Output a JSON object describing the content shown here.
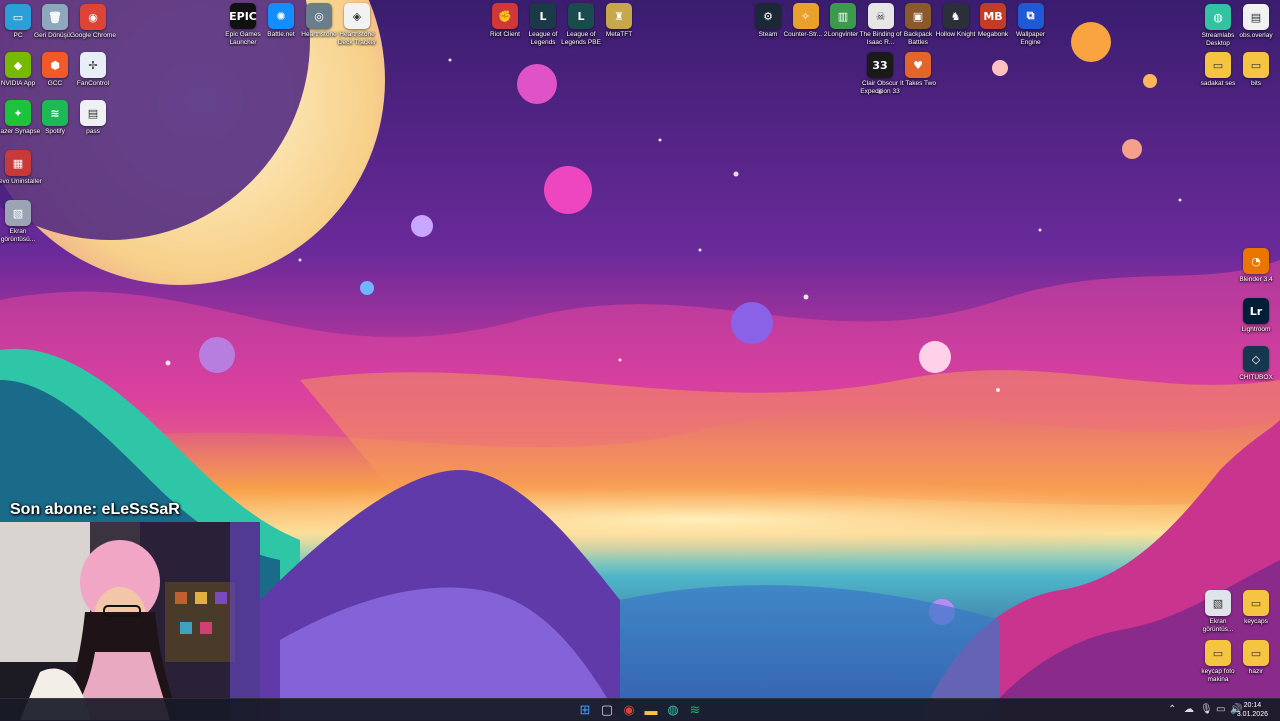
{
  "desktop": {
    "left_icons": [
      {
        "name": "pc",
        "label": "PC",
        "color": "#2a9fd8",
        "glyph": "▭"
      },
      {
        "name": "recycle-bin",
        "label": "Geri Dönüşü...",
        "color": "#8fa7bd",
        "glyph": "🗑"
      },
      {
        "name": "google-chrome",
        "label": "Google Chrome",
        "color": "#db4437",
        "glyph": "◉"
      },
      {
        "name": "nvidia-app",
        "label": "NVIDIA App",
        "color": "#76b900",
        "glyph": "◆"
      },
      {
        "name": "gcc",
        "label": "GCC",
        "color": "#f05a28",
        "glyph": "⬢"
      },
      {
        "name": "fancontrol",
        "label": "FanControl",
        "color": "#e8eef5",
        "glyph": "✢"
      },
      {
        "name": "razer-synapse",
        "label": "Razer Synapse",
        "color": "#1cc43c",
        "glyph": "✦"
      },
      {
        "name": "spotify",
        "label": "Spotify",
        "color": "#1db954",
        "glyph": "≋"
      },
      {
        "name": "pass",
        "label": "pass",
        "color": "#eef0f3",
        "glyph": "▤"
      },
      {
        "name": "revo-uninstaller",
        "label": "Revo Uninstaller",
        "color": "#c83a3a",
        "glyph": "▦"
      },
      {
        "name": "ekran-goruntusu-left",
        "label": "Ekran görüntüsü...",
        "color": "#9aa4b5",
        "glyph": "▧"
      }
    ],
    "top_icons_a": [
      {
        "name": "epic-games",
        "label": "Epic Games Launcher",
        "color": "#111111",
        "glyph": "EPIC"
      },
      {
        "name": "battlenet",
        "label": "Battle.net",
        "color": "#148eff",
        "glyph": "✺"
      },
      {
        "name": "hearthstone",
        "label": "Hearthstone",
        "color": "#6a7d8a",
        "glyph": "◎"
      },
      {
        "name": "hearthstone-deck-tracker",
        "label": "Hearthstone Deck Tracker",
        "color": "#f2f2f2",
        "glyph": "◈"
      }
    ],
    "top_icons_b": [
      {
        "name": "riot-client",
        "label": "Riot Client",
        "color": "#d13639",
        "glyph": "✊"
      },
      {
        "name": "league-of-legends",
        "label": "League of Legends",
        "color": "#1a3a48",
        "glyph": "L"
      },
      {
        "name": "league-of-legends-pbe",
        "label": "League of Legends PBE",
        "color": "#1a4c4e",
        "glyph": "L"
      },
      {
        "name": "metatft",
        "label": "MetaTFT",
        "color": "#c7a74c",
        "glyph": "♜"
      }
    ],
    "top_icons_c": [
      {
        "name": "steam",
        "label": "Steam",
        "color": "#1b2838",
        "glyph": "⚙"
      },
      {
        "name": "counter-strike-2",
        "label": "Counter-Str... 2",
        "color": "#e9a12c",
        "glyph": "✧"
      },
      {
        "name": "longvinter",
        "label": "Longvinter",
        "color": "#3c9a4e",
        "glyph": "▥"
      },
      {
        "name": "binding-of-isaac",
        "label": "The Binding of Isaac R...",
        "color": "#e6e6e6",
        "glyph": "☠"
      },
      {
        "name": "backpack-battles",
        "label": "Backpack Battles",
        "color": "#8a5a2b",
        "glyph": "▣"
      },
      {
        "name": "hollow-knight",
        "label": "Hollow Knight",
        "color": "#2a2f3a",
        "glyph": "♞"
      },
      {
        "name": "megabonk",
        "label": "Megabonk",
        "color": "#c33c28",
        "glyph": "MB"
      },
      {
        "name": "wallpaper-engine",
        "label": "Wallpaper Engine",
        "color": "#2059d6",
        "glyph": "⧉"
      }
    ],
    "top_icons_c2": [
      {
        "name": "clair-obscur",
        "label": "Clair Obscur Expedition 33",
        "color": "#1a1a1a",
        "glyph": "33"
      },
      {
        "name": "it-takes-two",
        "label": "It Takes Two",
        "color": "#e2662c",
        "glyph": "♥"
      }
    ],
    "right_icons": [
      {
        "name": "streamlabs",
        "label": "Streamlabs Desktop",
        "color": "#31c3a2",
        "glyph": "◍"
      },
      {
        "name": "obs-overlay",
        "label": "obs.overlay",
        "color": "#f1f1f1",
        "glyph": "▤"
      },
      {
        "name": "sadakat-ses",
        "label": "sadakat ses",
        "color": "#f5c542",
        "glyph": "▭"
      },
      {
        "name": "bits",
        "label": "bits",
        "color": "#f5c542",
        "glyph": "▭"
      },
      {
        "name": "blender",
        "label": "Blender 3.4",
        "color": "#ea7600",
        "glyph": "◔"
      },
      {
        "name": "lightroom",
        "label": "Lightroom",
        "color": "#001e36",
        "glyph": "Lr"
      },
      {
        "name": "chitubox",
        "label": "CHITUBOX",
        "color": "#15384e",
        "glyph": "◇"
      },
      {
        "name": "ekran-goruntusu-right",
        "label": "Ekran görüntüs...",
        "color": "#dfe3ea",
        "glyph": "▧"
      },
      {
        "name": "keycaps",
        "label": "keycaps",
        "color": "#f5c542",
        "glyph": "▭"
      },
      {
        "name": "keycap-foto-makina",
        "label": "keycap foto makina",
        "color": "#f5c542",
        "glyph": "▭"
      },
      {
        "name": "hazir",
        "label": "hazır",
        "color": "#f5c542",
        "glyph": "▭"
      }
    ]
  },
  "overlay": {
    "text": "Son abone: eLeSsSaR"
  },
  "taskbar": {
    "apps": [
      {
        "name": "start",
        "color": "#3aa0ff",
        "glyph": "⊞"
      },
      {
        "name": "task-view",
        "color": "#cfd4de",
        "glyph": "▢"
      },
      {
        "name": "chrome",
        "color": "#db4437",
        "glyph": "◉"
      },
      {
        "name": "file-explorer",
        "color": "#f5c542",
        "glyph": "▬"
      },
      {
        "name": "streamlabs",
        "color": "#31c3a2",
        "glyph": "◍"
      },
      {
        "name": "spotify",
        "color": "#1db954",
        "glyph": "≋"
      }
    ],
    "time": "20:14",
    "date": "3.01.2026"
  }
}
